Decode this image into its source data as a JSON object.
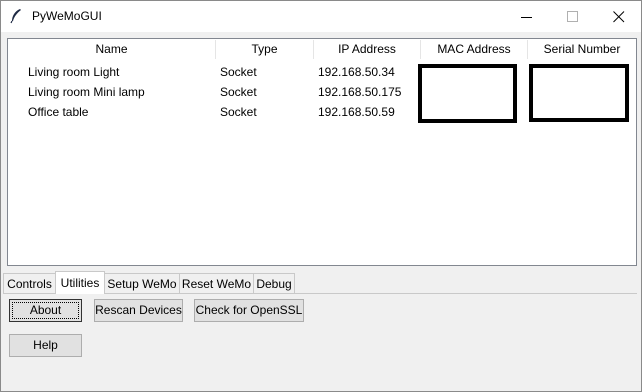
{
  "window": {
    "title": "PyWeMoGUI",
    "icon": "feather-icon",
    "controls": [
      "minimize-icon",
      "maximize-icon",
      "close-icon"
    ]
  },
  "table": {
    "columns": [
      "Name",
      "Type",
      "IP Address",
      "MAC Address",
      "Serial Number"
    ],
    "rows": [
      {
        "name": "Living room Light",
        "type": "Socket",
        "ip": "192.168.50.34"
      },
      {
        "name": "Living room Mini lamp",
        "type": "Socket",
        "ip": "192.168.50.175"
      },
      {
        "name": "Office table",
        "type": "Socket",
        "ip": "192.168.50.59"
      }
    ]
  },
  "tabs": [
    "Controls",
    "Utilities",
    "Setup WeMo",
    "Reset WeMo",
    "Debug"
  ],
  "active_tab": "Utilities",
  "buttons": {
    "about": "About",
    "rescan": "Rescan Devices",
    "openssl": "Check for OpenSSL",
    "help": "Help"
  }
}
